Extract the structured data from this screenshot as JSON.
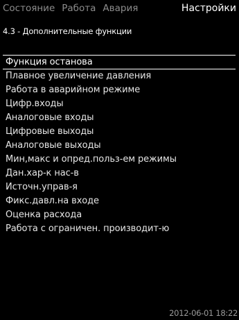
{
  "tabs": [
    {
      "label": "Состояние",
      "active": false
    },
    {
      "label": "Работа",
      "active": false
    },
    {
      "label": "Авария",
      "active": false
    },
    {
      "label": "Настройки",
      "active": true
    }
  ],
  "breadcrumb": "4.3 - Дополнительные функции",
  "menu": {
    "items": [
      "Функция останова",
      "Плавное увеличение давления",
      "Работа в аварийном режиме",
      "Цифр.входы",
      "Аналоговые входы",
      "Цифровые выходы",
      "Аналоговые выходы",
      "Мин,макс и опред.польз-ем режимы",
      "Дан.хар-к нас-в",
      "Источн.управ-я",
      "Фикс.давл.на входе",
      "Оценка расхода",
      "Работа с ограничен. производит-ю"
    ],
    "selected_index": 0
  },
  "timestamp": "2012-06-01 18:22"
}
